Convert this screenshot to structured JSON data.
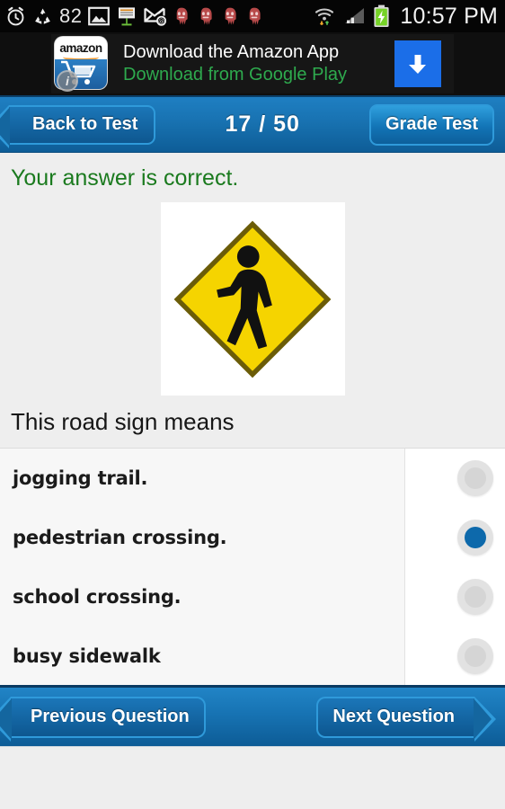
{
  "statusbar": {
    "icons": [
      {
        "name": "alarm-clock-icon",
        "glyph": "alarm"
      },
      {
        "name": "recycle-icon",
        "glyph": "recycle"
      },
      {
        "name": "gallery-icon",
        "glyph": "picture"
      },
      {
        "name": "presentation-icon",
        "glyph": "presentation"
      },
      {
        "name": "email-icon",
        "glyph": "mail-at"
      },
      {
        "name": "notification-icon-1",
        "glyph": "octopus"
      },
      {
        "name": "notification-icon-2",
        "glyph": "octopus"
      },
      {
        "name": "notification-icon-3",
        "glyph": "octopus"
      },
      {
        "name": "notification-icon-4",
        "glyph": "octopus"
      },
      {
        "name": "wifi-icon",
        "glyph": "wifi"
      },
      {
        "name": "signal-icon",
        "glyph": "signal"
      },
      {
        "name": "battery-charging-icon",
        "glyph": "battery"
      }
    ],
    "battery_percent": "82",
    "clock": "10:57 PM"
  },
  "ad": {
    "brand": "amazon",
    "info_badge": "i",
    "title": "Download the Amazon App",
    "subtitle": "Download from Google Play",
    "download_button": "download-arrow-icon"
  },
  "topnav": {
    "back_label": "Back to Test",
    "counter": "17 / 50",
    "grade_label": "Grade Test"
  },
  "feedback": {
    "text": "Your answer is correct.",
    "color": "#1a7a1e"
  },
  "sign": {
    "alt": "pedestrian-crossing-sign",
    "sign_color": "#f5d400",
    "border_color": "#6b5c08",
    "figure_color": "#111111"
  },
  "question": {
    "text": "This road sign means"
  },
  "answers": [
    {
      "label": "jogging trail.",
      "selected": false
    },
    {
      "label": "pedestrian crossing.",
      "selected": true
    },
    {
      "label": "school crossing.",
      "selected": false
    },
    {
      "label": "busy sidewalk",
      "selected": false
    }
  ],
  "botnav": {
    "prev_label": "Previous Question",
    "next_label": "Next Question"
  },
  "colors": {
    "accent_blue": "#1873b4",
    "selected_radio": "#0d69ab",
    "page_bg": "#eeeeee",
    "answers_bg": "#f7f7f7"
  }
}
